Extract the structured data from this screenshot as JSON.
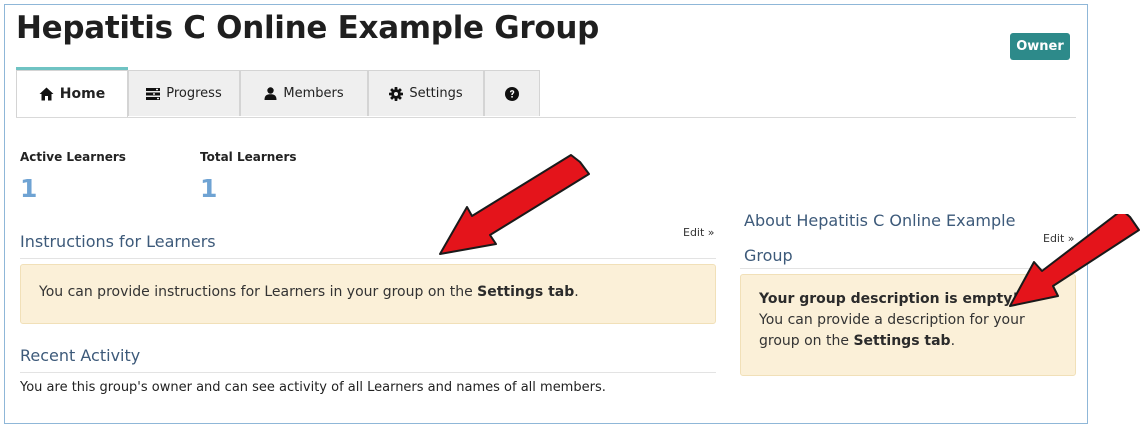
{
  "header": {
    "title": "Hepatitis C Online Example Group",
    "role_badge": "Owner"
  },
  "tabs": [
    {
      "label": "Home",
      "icon": "home-icon",
      "active": true
    },
    {
      "label": "Progress",
      "icon": "progress-icon",
      "active": false
    },
    {
      "label": "Members",
      "icon": "user-icon",
      "active": false
    },
    {
      "label": "Settings",
      "icon": "gear-icon",
      "active": false
    },
    {
      "label": "",
      "icon": "help-icon",
      "active": false
    }
  ],
  "stats": {
    "active_label": "Active Learners",
    "active_value": "1",
    "total_label": "Total Learners",
    "total_value": "1"
  },
  "instructions": {
    "heading": "Instructions for Learners",
    "edit_label": "Edit »",
    "notice_prefix": "You can provide instructions for Learners in your group on the ",
    "notice_link": "Settings tab",
    "notice_suffix": "."
  },
  "recent_activity": {
    "heading": "Recent Activity",
    "text": "You are this group's owner and can see activity of all Learners and names of all members."
  },
  "about": {
    "heading": "About Hepatitis C Online Example Group",
    "edit_label": "Edit »",
    "empty_title": "Your group description is empty!",
    "notice_prefix": "You can provide a description for your group on the ",
    "notice_link": "Settings tab",
    "notice_suffix": "."
  },
  "colors": {
    "badge": "#2d8a8a",
    "tab_accent": "#6fc3c3",
    "stat_value": "#6fa3d3",
    "heading": "#3d5a7a",
    "notice_bg": "#fbf0d8",
    "arrow": "#e4141b"
  }
}
